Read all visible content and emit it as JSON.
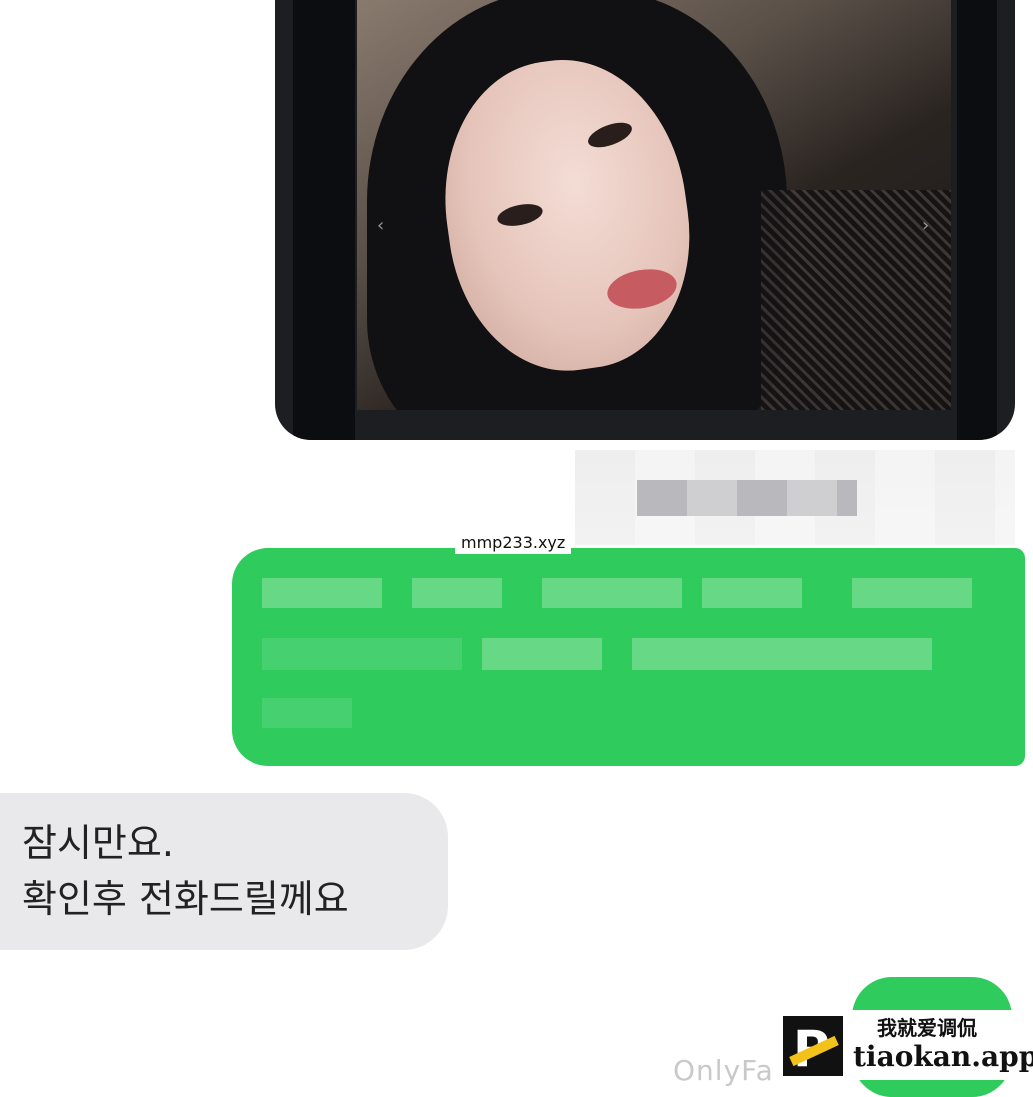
{
  "watermark_top": "mmp233.xyz",
  "received_message": {
    "line1": "잠시만요.",
    "line2": "확인후 전화드릴께요"
  },
  "footer_faded_text": "OnlyFa",
  "logo": {
    "chinese_text": "我就爱调侃",
    "domain": "tiaokan.app"
  },
  "colors": {
    "sent_bubble": "#2fcb5c",
    "received_bubble": "#e9e9eb",
    "background": "#ffffff"
  },
  "icons": {
    "photo_prev": "chevron-left-icon",
    "photo_next": "chevron-right-icon",
    "logo": "p-lightning-logo-icon"
  }
}
